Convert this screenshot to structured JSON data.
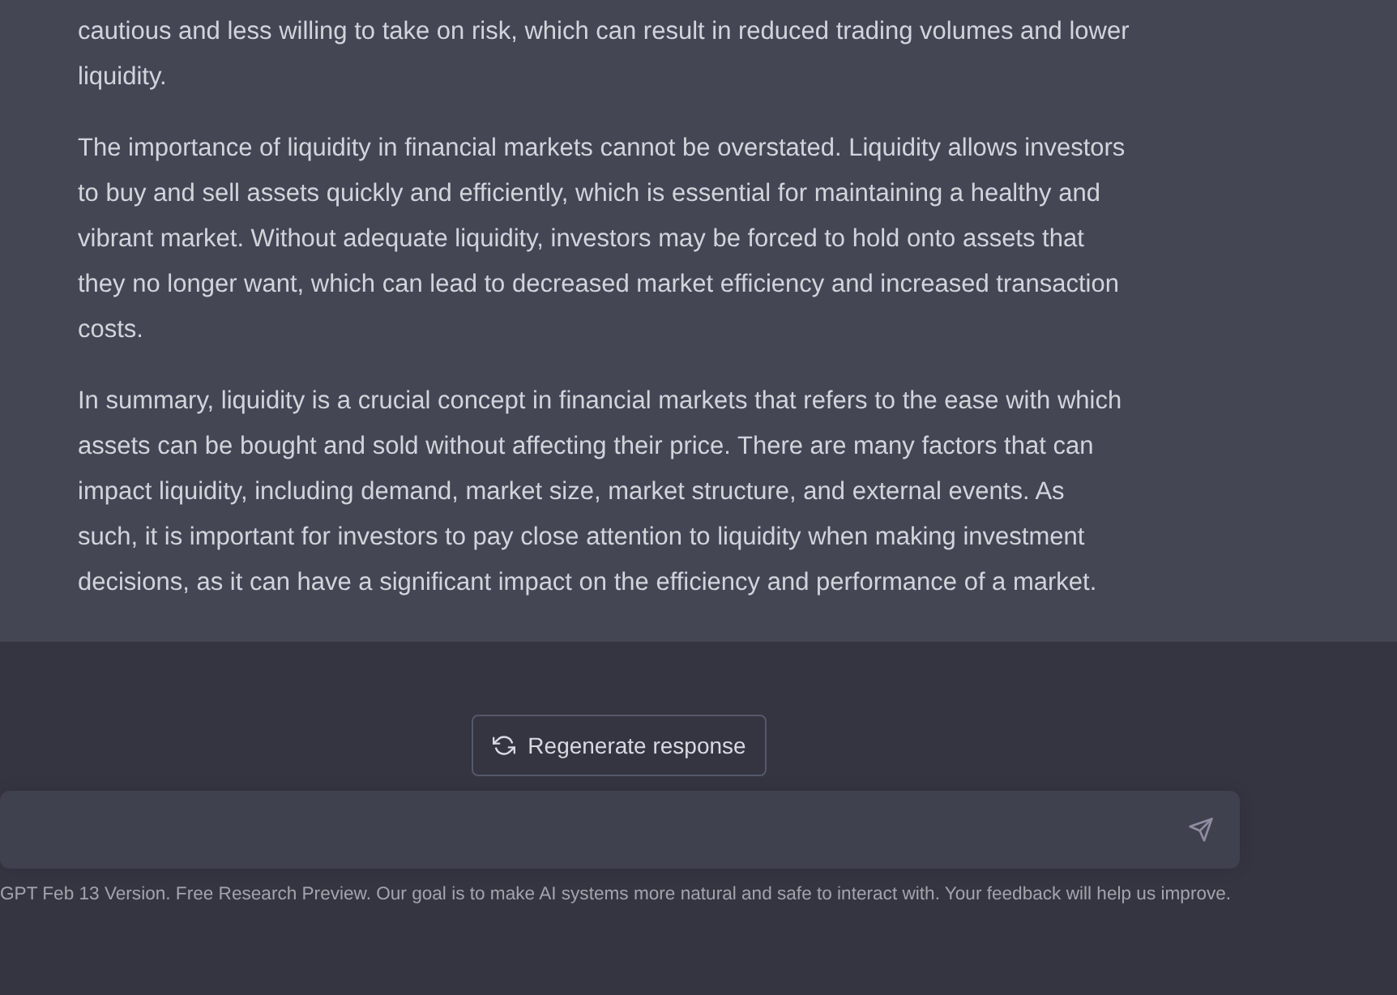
{
  "message": {
    "paragraphs": [
      "cautious and less willing to take on risk, which can result in reduced trading volumes and lower liquidity.",
      "The importance of liquidity in financial markets cannot be overstated. Liquidity allows investors to buy and sell assets quickly and efficiently, which is essential for maintaining a healthy and vibrant market. Without adequate liquidity, investors may be forced to hold onto assets that they no longer want, which can lead to decreased market efficiency and increased transaction costs.",
      "In summary, liquidity is a crucial concept in financial markets that refers to the ease with which assets can be bought and sold without affecting their price. There are many factors that can impact liquidity, including demand, market size, market structure, and external events. As such, it is important for investors to pay close attention to liquidity when making investment decisions, as it can have a significant impact on the efficiency and performance of a market."
    ]
  },
  "regenerate_button": {
    "label": "Regenerate response"
  },
  "footer": "GPT Feb 13 Version. Free Research Preview. Our goal is to make AI systems more natural and safe to interact with. Your feedback will help us improve."
}
